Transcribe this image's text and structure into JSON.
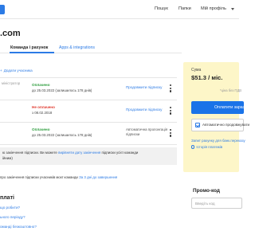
{
  "topnav": {
    "help": "Пошук",
    "folders": "Папки",
    "profile": "Мій профіль"
  },
  "page": {
    "title": ".com"
  },
  "tabs": [
    {
      "label": ""
    },
    {
      "label": "Команда і рахунок"
    },
    {
      "label": "Apps & integrations"
    }
  ],
  "members": {
    "add_label": "Додати учасника",
    "rows": [
      {
        "role": "міністратор",
        "status": "Оплачено",
        "until": "до 25.03.2022 (залишилось 178 днів)",
        "action": "Продовжити підписку"
      },
      {
        "role": "",
        "status": "Не оплачено",
        "until": "з 08.02.2018",
        "action": "Продовжити підписку"
      },
      {
        "role": "",
        "status": "Оплачено",
        "until": "до 25.03.2022 (залишилось 178 днів)",
        "action": "Автоматична пролонгація підписки"
      }
    ]
  },
  "notice": {
    "before": "ю закінчення підписки. Ви можете",
    "link": "вирівняти дату закінчення",
    "after": "підписки усієї команди",
    "line2": "ійним)"
  },
  "check_line": {
    "before": "про закінчення підписки учасників моєї команди",
    "link": "За 3 дні до завершення"
  },
  "faq": {
    "title": "платі",
    "items": [
      "що робити?",
      "ьного періоду?",
      "оманді безкоштовно?"
    ]
  },
  "summary": {
    "sum_label": "Сума",
    "sum_value": "$51.3 / міс.",
    "vat_note": "*ціна без ПДВ",
    "pay_button": "Оплатити зараз",
    "auto_renew": "Автоматично продовжувати",
    "invoice_link": "Запит рахунку для банк.переказу",
    "history_link": "Історія платежів"
  },
  "promo": {
    "label": "Промо-код",
    "placeholder": "Введіть код"
  }
}
